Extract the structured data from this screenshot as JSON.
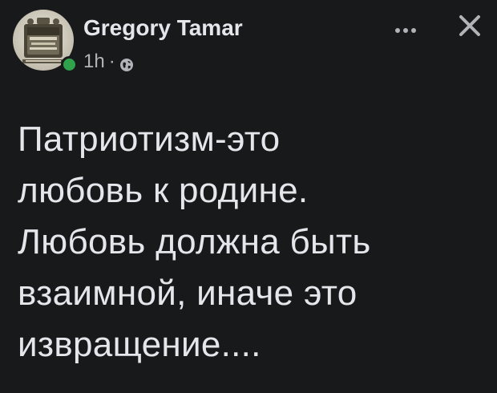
{
  "post": {
    "author": {
      "name": "Gregory Tamar",
      "avatar_icon": "avatar-image-icon",
      "online_status_color": "#31a24c"
    },
    "meta": {
      "timestamp": "1h",
      "separator": "·",
      "audience_icon": "globe-icon"
    },
    "actions": {
      "more_icon": "more-options-icon",
      "close_icon": "close-icon"
    },
    "text_lines": [
      "Патриотизм-это",
      "любовь к родине.",
      "Любовь должна быть",
      "взаимной, иначе это",
      "извращение...."
    ]
  },
  "colors": {
    "background": "#18191a",
    "primary_text": "#e4e6eb",
    "secondary_text": "#b0b3b8",
    "online": "#31a24c"
  }
}
